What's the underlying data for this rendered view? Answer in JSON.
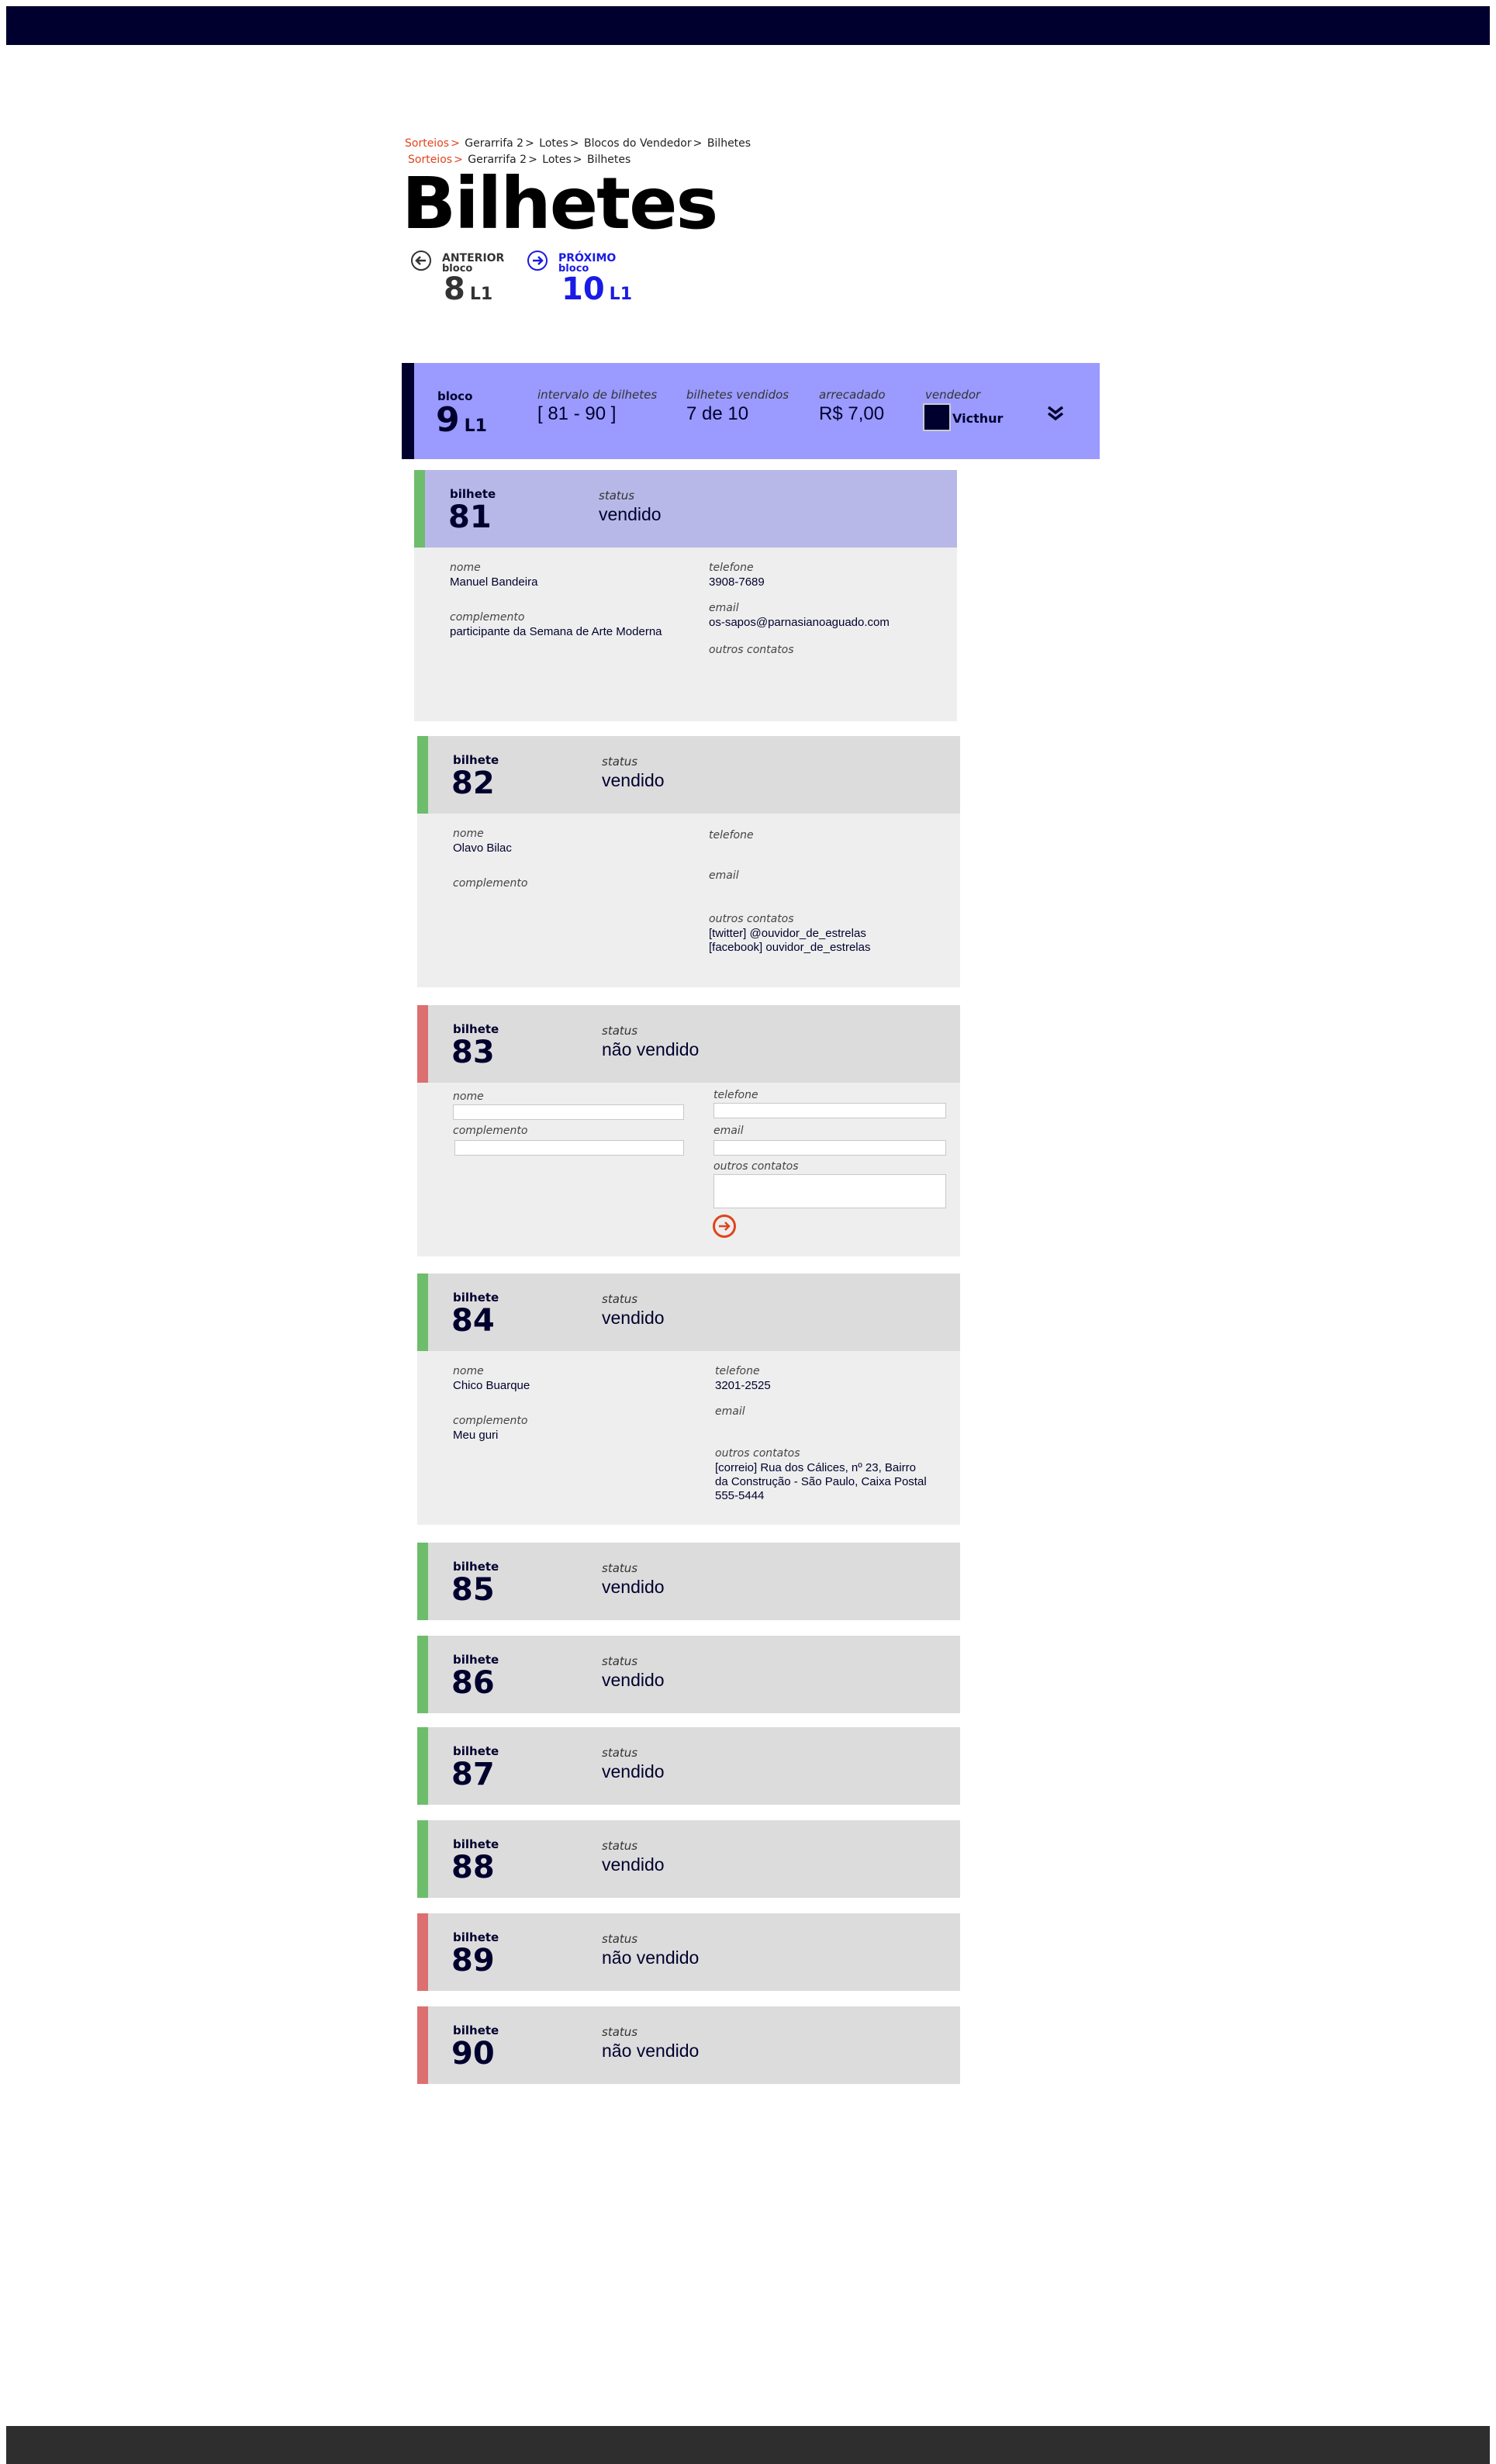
{
  "breadcrumbs": [
    [
      "Sorteios",
      "Gerarrifa 2",
      "Lotes",
      "Blocos do Vendedor",
      "Bilhetes"
    ],
    [
      "Sorteios",
      "Gerarrifa 2",
      "Lotes",
      "Bilhetes"
    ]
  ],
  "page_title": "Bilhetes",
  "nav": {
    "prev": {
      "label": "ANTERIOR",
      "sub": "bloco",
      "number": "8",
      "lote": "L1"
    },
    "next": {
      "label": "PRÓXIMO",
      "sub": "bloco",
      "number": "10",
      "lote": "L1"
    }
  },
  "block": {
    "bloco_label": "bloco",
    "bloco_number": "9",
    "bloco_lote": "L1",
    "intervalo_label": "intervalo de bilhetes",
    "intervalo_value": "[ 81 - 90 ]",
    "vendidos_label": "bilhetes vendidos",
    "vendidos_value": "7 de 10",
    "arrecadado_label": "arrecadado",
    "arrecadado_value": "R$ 7,00",
    "vendedor_label": "vendedor",
    "vendedor_name": "Victhur"
  },
  "labels": {
    "bilhete": "bilhete",
    "status": "status",
    "nome": "nome",
    "complemento": "complemento",
    "telefone": "telefone",
    "email": "email",
    "outros_contatos": "outros contatos"
  },
  "tickets": [
    {
      "number": "81",
      "status": "vendido",
      "nome": "Manuel Bandeira",
      "complemento": "participante da Semana de Arte Moderna",
      "telefone": "3908-7689",
      "email": "os-sapos@parnasianoaguado.com",
      "outros": []
    },
    {
      "number": "82",
      "status": "vendido",
      "nome": "Olavo Bilac",
      "complemento": "",
      "telefone": "",
      "email": "",
      "outros": [
        "[twitter] @ouvidor_de_estrelas",
        "[facebook] ouvidor_de_estrelas"
      ]
    },
    {
      "number": "83",
      "status": "não vendido"
    },
    {
      "number": "84",
      "status": "vendido",
      "nome": "Chico Buarque",
      "complemento": "Meu guri",
      "telefone": "3201-2525",
      "email": "",
      "outros": [
        "[correio] Rua dos Cálices, nº 23, Bairro",
        "da Construção - São Paulo, Caixa Postal",
        "555-5444"
      ]
    },
    {
      "number": "85",
      "status": "vendido"
    },
    {
      "number": "86",
      "status": "vendido"
    },
    {
      "number": "87",
      "status": "vendido"
    },
    {
      "number": "88",
      "status": "vendido"
    },
    {
      "number": "89",
      "status": "não vendido"
    },
    {
      "number": "90",
      "status": "não vendido"
    }
  ],
  "colors": {
    "topbar": "#00002e",
    "footer": "#2e2e2e",
    "block_header": "#9a9aff",
    "sold": "#6dbd6d",
    "unsold": "#dc7070",
    "accent": "#e0441c",
    "next_link": "#1a1ae6"
  }
}
